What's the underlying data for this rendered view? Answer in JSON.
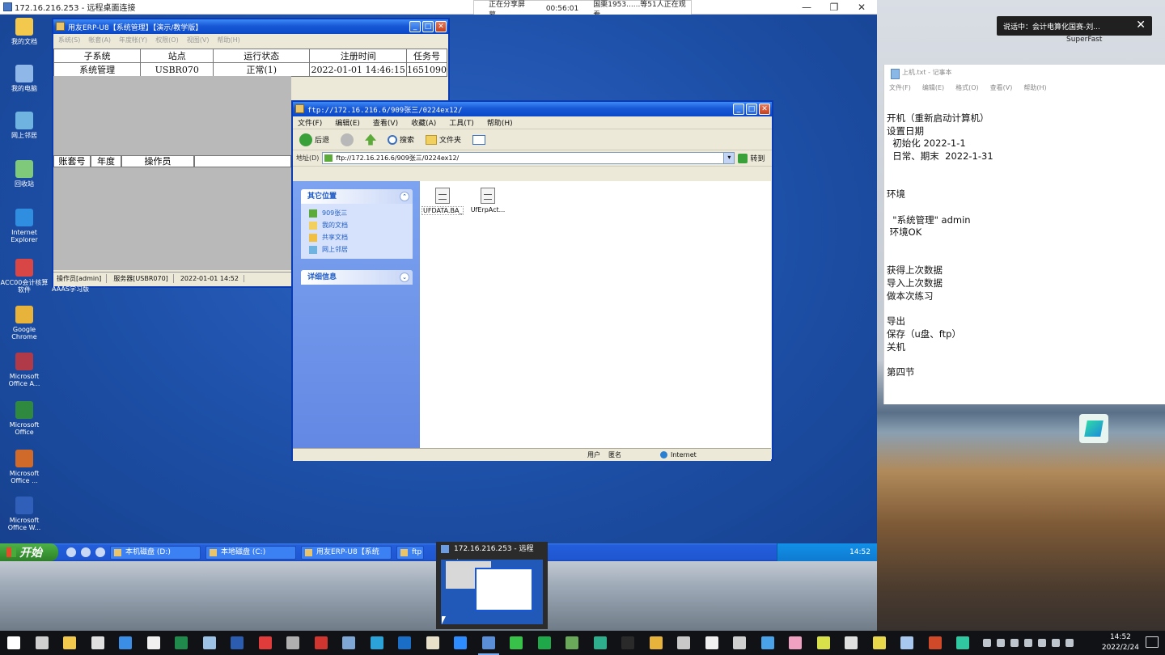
{
  "remote_window": {
    "title": "172.16.216.253 - 远程桌面连接",
    "share_status": "正在分享屏幕",
    "share_time": "00:56:01",
    "share_viewers": "国栗1953......等51人正在观看"
  },
  "desktop_icons": [
    {
      "label": "我的文档",
      "color": "#f2c94c"
    },
    {
      "label": "我的电脑",
      "color": "#8fb7e8"
    },
    {
      "label": "网上邻居",
      "color": "#6fb3e0"
    },
    {
      "label": "回收站",
      "color": "#7ec97a"
    },
    {
      "label": "Internet Explorer",
      "color": "#2f8ee0"
    },
    {
      "label": "ACC00会计核算软件",
      "color": "#d94646"
    },
    {
      "label": "Google Chrome",
      "color": "#e8b33a"
    },
    {
      "label": "Microsoft Office A...",
      "color": "#b03a48"
    },
    {
      "label": "Microsoft Office",
      "color": "#2f8a3f"
    },
    {
      "label": "Microsoft Office ...",
      "color": "#d06a2a"
    },
    {
      "label": "Microsoft Office W...",
      "color": "#2f5fb8"
    }
  ],
  "erp_window": {
    "title": "用友ERP-U8【系统管理】【演示/教学版】",
    "menu": [
      "系统(S)",
      "帐套(A)",
      "年度帐(Y)",
      "权限(O)",
      "视图(V)",
      "帮助(H)"
    ],
    "table_headers": [
      "子系统",
      "站点",
      "运行状态",
      "注册时间",
      "任务号"
    ],
    "table_row": [
      "系统管理",
      "USBR070",
      "正常(1)",
      "2022-01-01 14:46:15",
      "1651090"
    ],
    "grid2_headers": [
      "账套号",
      "年度",
      "操作员"
    ],
    "status": [
      "操作员[admin]",
      "服务器[USBR070]",
      "2022-01-01 14:52"
    ],
    "below_label": "AAAS学习版"
  },
  "ftp_window": {
    "title": "ftp://172.16.216.6/909张三/0224ex12/",
    "menu": [
      "文件(F)",
      "编辑(E)",
      "查看(V)",
      "收藏(A)",
      "工具(T)",
      "帮助(H)"
    ],
    "toolbar": {
      "back": "后退",
      "search": "搜索",
      "folders": "文件夹"
    },
    "address_label": "地址(D)",
    "address": "ftp://172.16.216.6/909张三/0224ex12/",
    "go": "转到",
    "panel_other": "其它位置",
    "panel_other_items": [
      "909张三",
      "我的文档",
      "共享文档",
      "网上邻居"
    ],
    "panel_details": "详细信息",
    "files": [
      "UFDATA.BA_",
      "UfErpAct..."
    ],
    "status_user": "用户",
    "status_anon": "匿名",
    "status_zone": "Internet"
  },
  "xp_taskbar": {
    "start": "开始",
    "tasks": [
      "本机磁盘 (D:)",
      "本地磁盘 (C:)",
      "用友ERP-U8【系统",
      "ftp"
    ],
    "clock": "14:52"
  },
  "meeting_toast": {
    "text": "说话中：会计电算化国赛-刘...",
    "brand": "SuperFast"
  },
  "notepad": {
    "title": "上机.txt - 记事本",
    "menu": [
      "文件(F)",
      "编辑(E)",
      "格式(O)",
      "查看(V)",
      "帮助(H)"
    ],
    "lines": [
      "开机（重新启动计算机）",
      "设置日期",
      "  初始化 2022-1-1",
      "  日常、期末  2022-1-31",
      "",
      "",
      "环境",
      "",
      "  \"系统管理\" admin",
      " 环境OK",
      "",
      "",
      "获得上次数据",
      "导入上次数据",
      "做本次练习",
      "",
      "导出",
      "保存（u盘、ftp）",
      "关机",
      "",
      "第四节"
    ]
  },
  "thumbnail": {
    "title": "172.16.216.253 - 远程桌..."
  },
  "w10_taskbar": {
    "icons": [
      {
        "name": "start-icon",
        "color": "#ffffff"
      },
      {
        "name": "search-icon",
        "color": "#d0d0d0"
      },
      {
        "name": "file-explorer-icon",
        "color": "#f2c94c"
      },
      {
        "name": "edge-old-icon",
        "color": "#e0e0e0"
      },
      {
        "name": "mail-icon",
        "color": "#3a8ee6"
      },
      {
        "name": "qq-icon",
        "color": "#f0f0f0"
      },
      {
        "name": "excel-icon",
        "color": "#1f8a4c"
      },
      {
        "name": "notepad-icon",
        "color": "#9cc3e6"
      },
      {
        "name": "word-icon",
        "color": "#2b5cb0"
      },
      {
        "name": "gift-icon",
        "color": "#e03c3c"
      },
      {
        "name": "usb-icon",
        "color": "#b0b0b0"
      },
      {
        "name": "acrobat-icon",
        "color": "#d0352f"
      },
      {
        "name": "app-icon",
        "color": "#7fa7d6"
      },
      {
        "name": "edge-icon",
        "color": "#2ba3d8"
      },
      {
        "name": "outlook-icon",
        "color": "#1a6ec6"
      },
      {
        "name": "onenote-icon",
        "color": "#e8e0c8"
      },
      {
        "name": "zoom-icon",
        "color": "#2d8cff"
      },
      {
        "name": "remote-desktop-icon",
        "color": "#5a8fd8"
      },
      {
        "name": "wechat-icon",
        "color": "#38c24a"
      },
      {
        "name": "green-app-icon",
        "color": "#1fa84a"
      },
      {
        "name": "image-icon",
        "color": "#6aa85a"
      },
      {
        "name": "map-icon",
        "color": "#2fae8e"
      },
      {
        "name": "terminal-icon",
        "color": "#2a2a2a"
      },
      {
        "name": "chrome-icon",
        "color": "#e8b33a"
      },
      {
        "name": "calculator-icon",
        "color": "#c8c8c8"
      },
      {
        "name": "paint-icon",
        "color": "#f0f0f0"
      },
      {
        "name": "settings-icon",
        "color": "#d0d0d0"
      },
      {
        "name": "search-app-icon",
        "color": "#4aa3e8"
      },
      {
        "name": "music-icon",
        "color": "#f0a0c0"
      },
      {
        "name": "circle-app-icon",
        "color": "#d8e04a"
      },
      {
        "name": "steam-icon",
        "color": "#e0e0e0"
      },
      {
        "name": "camera-icon",
        "color": "#e8d84a"
      },
      {
        "name": "note-icon",
        "color": "#a8c8f0"
      },
      {
        "name": "powerpoint-icon",
        "color": "#d04a2a"
      },
      {
        "name": "swift-icon",
        "color": "#2fc8a0"
      }
    ],
    "clock_time": "14:52",
    "clock_date": "2022/2/24"
  }
}
